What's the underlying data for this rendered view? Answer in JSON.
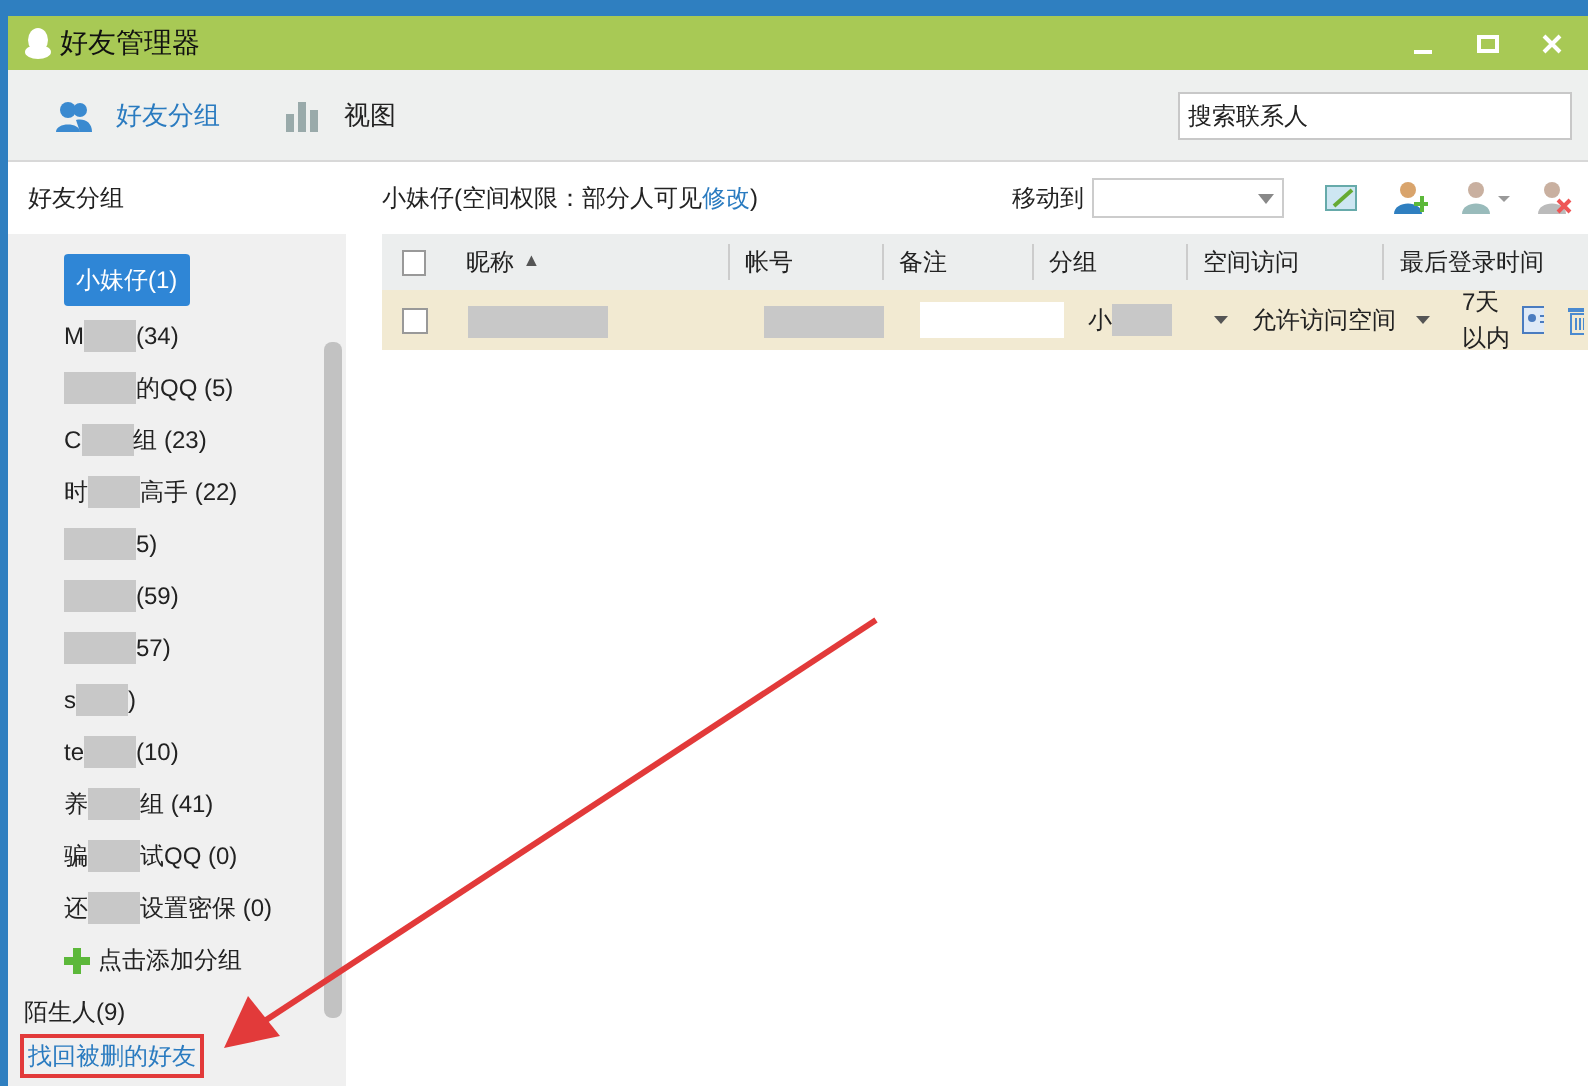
{
  "window": {
    "title": "好友管理器"
  },
  "toolbar": {
    "tabs": [
      {
        "label": "好友分组",
        "selected": true
      },
      {
        "label": "视图",
        "selected": false
      }
    ],
    "search": {
      "placeholder": "搜索联系人"
    }
  },
  "sidebar": {
    "heading": "好友分组",
    "groups": [
      {
        "label_start": "小妹仔(1)",
        "selected": true
      },
      {
        "label_start": "M",
        "label_end": "(34)",
        "selected": false
      },
      {
        "label_end": "的QQ (5)",
        "selected": false
      },
      {
        "label_start": "C",
        "label_end": "组 (23)",
        "selected": false
      },
      {
        "label_start": "时",
        "label_end": "高手 (22)",
        "selected": false
      },
      {
        "label_end": "5)",
        "selected": false
      },
      {
        "label_end": "(59)",
        "selected": false
      },
      {
        "label_end": "57)",
        "selected": false
      },
      {
        "label_start": "s",
        "label_end": ")",
        "selected": false
      },
      {
        "label_start": "te",
        "label_end": "(10)",
        "selected": false
      },
      {
        "label_start": "养",
        "label_end": "组 (41)",
        "selected": false
      },
      {
        "label_start": "骗",
        "label_end": "试QQ (0)",
        "selected": false
      },
      {
        "label_start": "还",
        "label_end": "设置密保 (0)",
        "selected": false
      }
    ],
    "add_group": "点击添加分组",
    "strangers": "陌生人(9)",
    "recover_link": "找回被删的好友"
  },
  "panel": {
    "group_title": "小妹仔(空间权限：部分人可见",
    "modify_link": "修改",
    "group_title_end": ")",
    "move_to_label": "移动到",
    "table": {
      "columns": [
        "昵称",
        "帐号",
        "备注",
        "分组",
        "空间访问",
        "最后登录时间"
      ],
      "sort_indicator": "▲",
      "select_all_checked": false,
      "rows": [
        {
          "checked": false,
          "group_start": "小",
          "space_access": "允许访问空间",
          "last_login": "7天以内"
        }
      ]
    }
  }
}
